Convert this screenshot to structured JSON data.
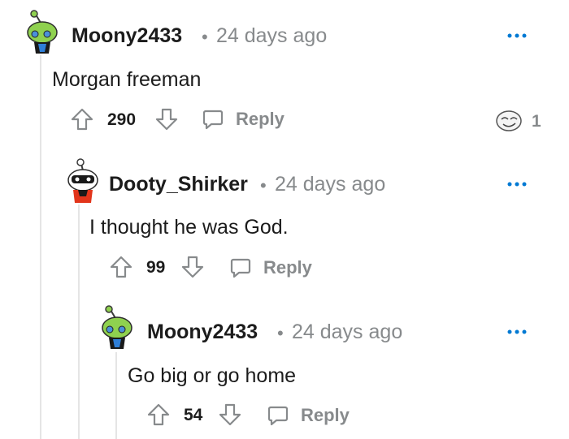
{
  "comments": [
    {
      "username": "Moony2433",
      "separator": "•",
      "timestamp": "24 days ago",
      "body": "Morgan freeman",
      "score": "290",
      "reply_label": "Reply",
      "award_count": "1",
      "avatar": "snoo-avatar-green-icon"
    },
    {
      "username": "Dooty_Shirker",
      "separator": "•",
      "timestamp": "24 days ago",
      "body": "I thought he was God.",
      "score": "99",
      "reply_label": "Reply",
      "avatar": "snoo-avatar-red-icon"
    },
    {
      "username": "Moony2433",
      "separator": "•",
      "timestamp": "24 days ago",
      "body": "Go big or go home",
      "score": "54",
      "reply_label": "Reply",
      "avatar": "snoo-avatar-green-icon"
    }
  ],
  "colors": {
    "text": "#1c1c1c",
    "meta": "#878a8c",
    "thread_line": "#e5e5e5",
    "more_dots": "#0079d3"
  }
}
